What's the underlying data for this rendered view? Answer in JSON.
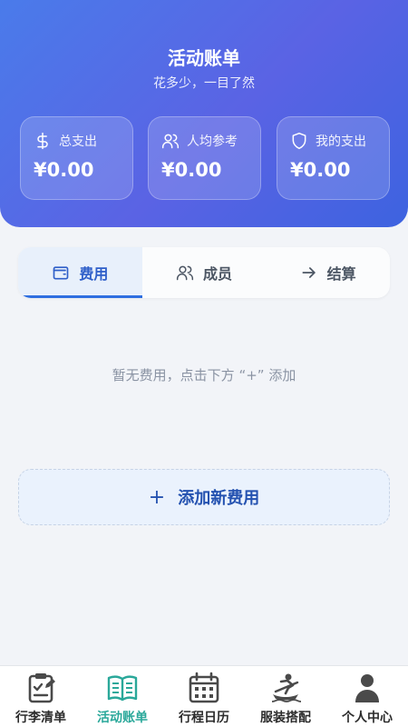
{
  "header": {
    "title": "活动账单",
    "subtitle": "花多少，一目了然"
  },
  "stats": [
    {
      "label": "总支出",
      "value": "¥0.00",
      "icon": "dollar-icon"
    },
    {
      "label": "人均参考",
      "value": "¥0.00",
      "icon": "users-icon"
    },
    {
      "label": "我的支出",
      "value": "¥0.00",
      "icon": "shield-icon"
    }
  ],
  "tabs": [
    {
      "label": "费用",
      "icon": "wallet-icon",
      "active": true
    },
    {
      "label": "成员",
      "icon": "users-icon",
      "active": false
    },
    {
      "label": "结算",
      "icon": "arrow-right-icon",
      "active": false
    }
  ],
  "empty_state": {
    "text": "暂无费用，点击下方 “+” 添加"
  },
  "add_button": {
    "symbol": "+",
    "label": "添加新费用"
  },
  "bottom_nav": [
    {
      "label": "行李清单",
      "icon": "checklist-icon",
      "active": false
    },
    {
      "label": "活动账单",
      "icon": "book-icon",
      "active": true
    },
    {
      "label": "行程日历",
      "icon": "calendar-icon",
      "active": false
    },
    {
      "label": "服装搭配",
      "icon": "outfit-icon",
      "active": false
    },
    {
      "label": "个人中心",
      "icon": "person-icon",
      "active": false
    }
  ],
  "colors": {
    "header_gradient_start": "#4a7bea",
    "header_gradient_end": "#3d63e0",
    "active_tab": "#2f5fc9",
    "active_nav": "#2aa89a",
    "add_button_text": "#2452b0"
  }
}
